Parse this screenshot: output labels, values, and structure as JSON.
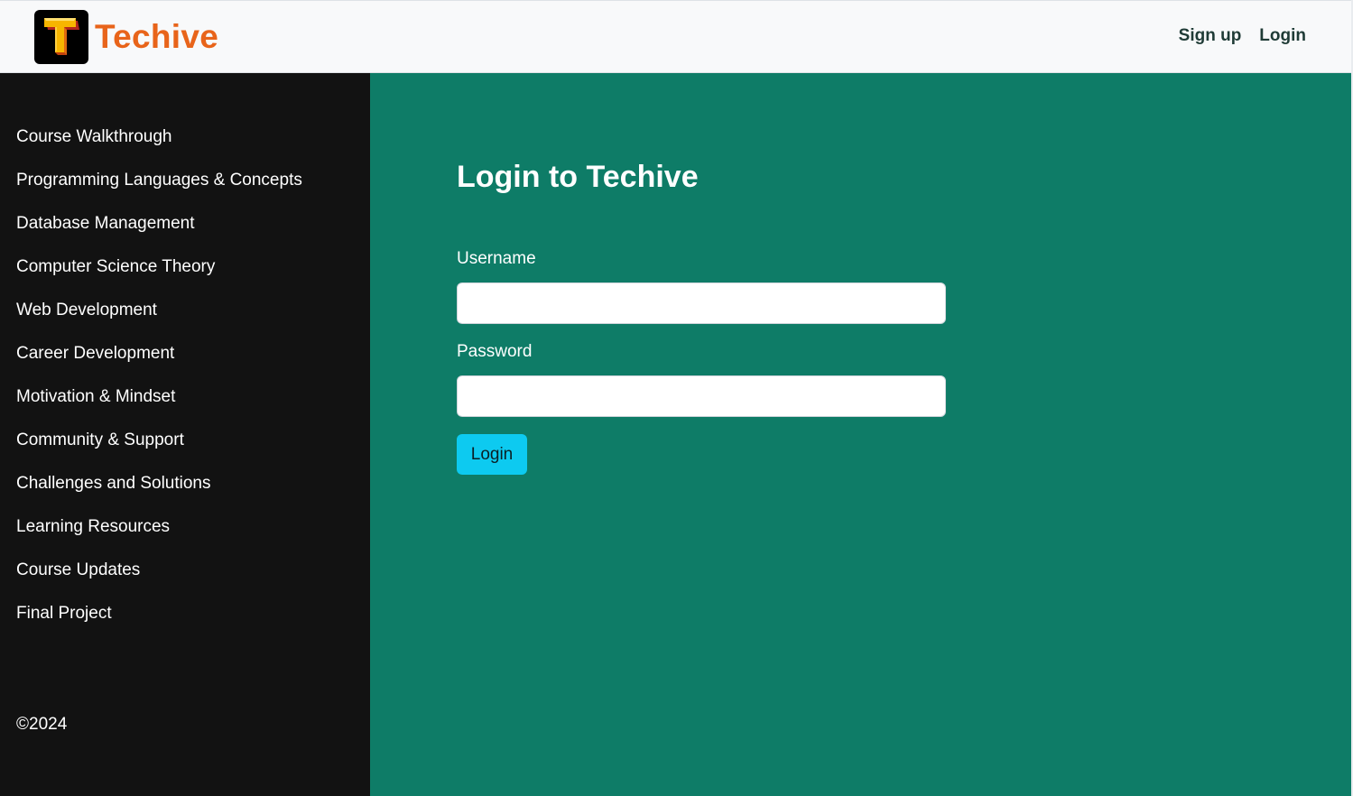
{
  "header": {
    "brand_name": "Techive",
    "logo_letter": "T",
    "nav": [
      {
        "label": "Sign up"
      },
      {
        "label": "Login"
      }
    ]
  },
  "sidebar": {
    "items": [
      {
        "label": "Course Walkthrough"
      },
      {
        "label": "Programming Languages & Concepts"
      },
      {
        "label": "Database Management"
      },
      {
        "label": "Computer Science Theory"
      },
      {
        "label": "Web Development"
      },
      {
        "label": "Career Development"
      },
      {
        "label": "Motivation & Mindset"
      },
      {
        "label": "Community & Support"
      },
      {
        "label": "Challenges and Solutions"
      },
      {
        "label": "Learning Resources"
      },
      {
        "label": "Course Updates"
      },
      {
        "label": "Final Project"
      }
    ],
    "copyright": "©2024"
  },
  "main": {
    "title": "Login to Techive",
    "username_label": "Username",
    "username_value": "",
    "password_label": "Password",
    "password_value": "",
    "login_button": "Login"
  },
  "colors": {
    "brand_orange": "#e8641a",
    "main_green": "#0e7c67",
    "sidebar_black": "#121212",
    "button_cyan": "#0dcaf0",
    "header_bg": "#f8f9fa"
  },
  "icons": {
    "logo": "techive-t-logo-icon"
  }
}
